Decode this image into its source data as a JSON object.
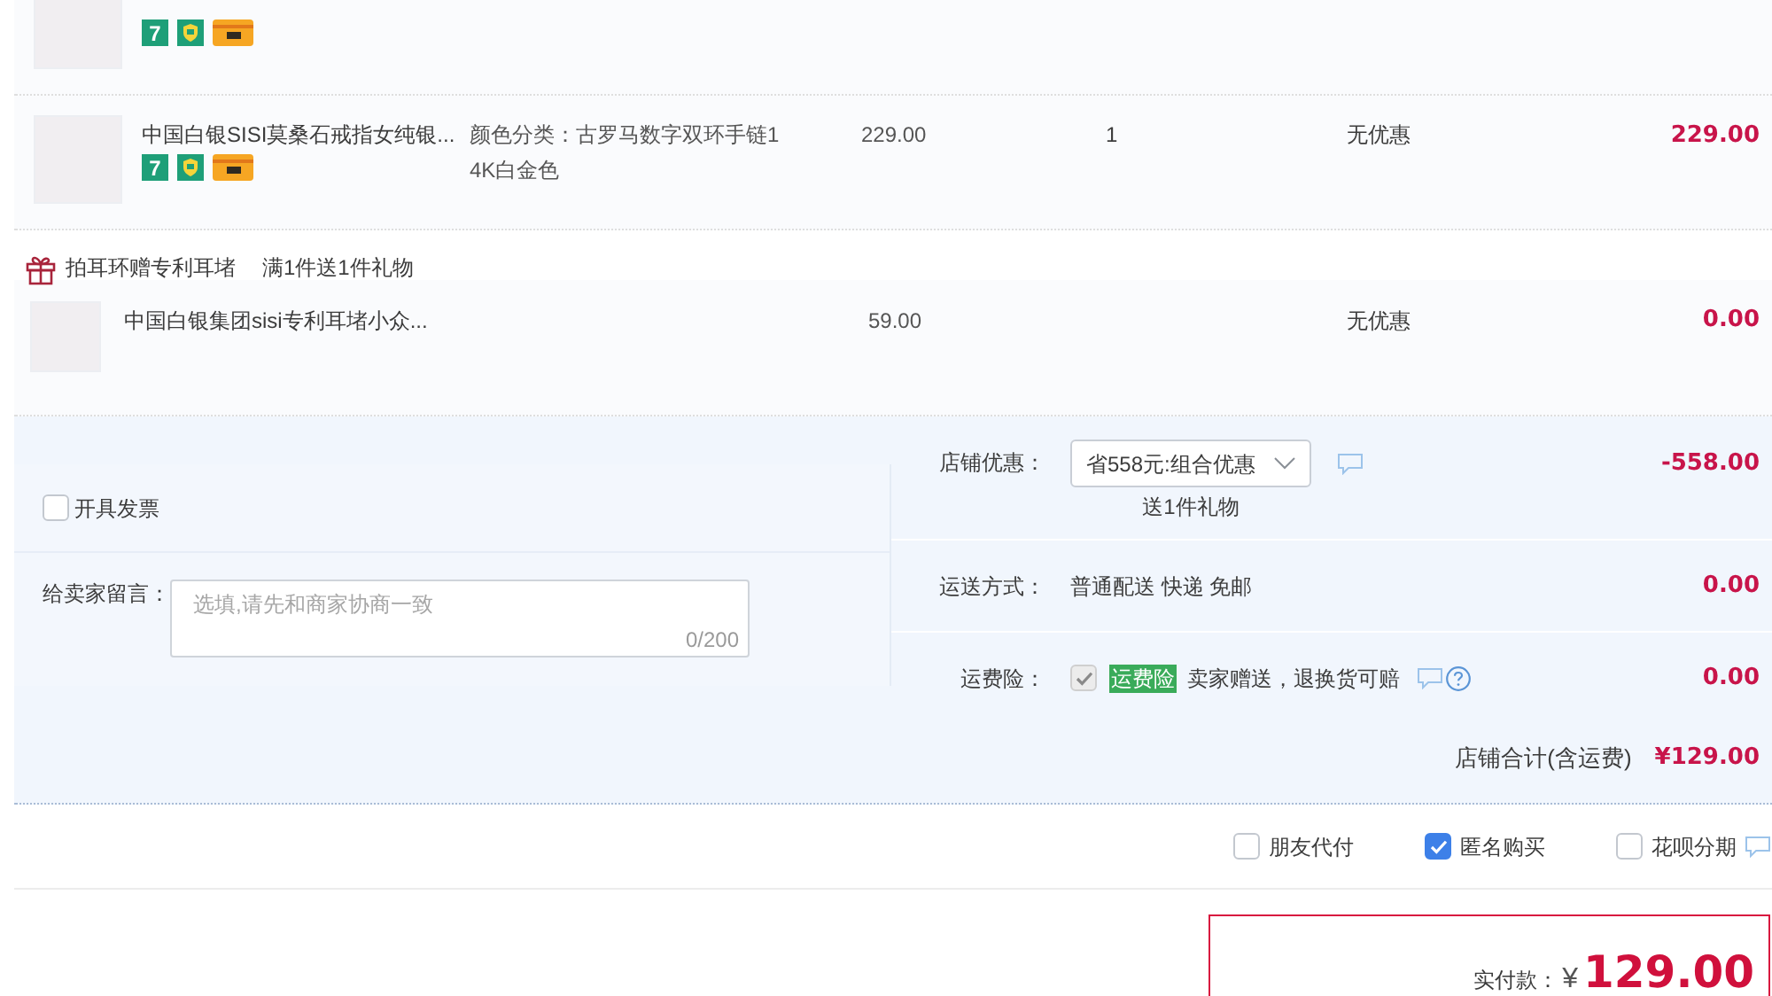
{
  "items": [
    {
      "badges": [
        {
          "kind": "seven",
          "label": "7"
        },
        {
          "kind": "shield"
        },
        {
          "kind": "card"
        }
      ]
    },
    {
      "title": "中国白银SISI莫桑石戒指女纯银...",
      "badges": [
        {
          "kind": "seven",
          "label": "7"
        },
        {
          "kind": "shield"
        },
        {
          "kind": "card"
        }
      ],
      "variant": "颜色分类：古罗马数字双环手链14K白金色",
      "price": "229.00",
      "quantity": "1",
      "discount": "无优惠",
      "subtotal": "229.00"
    }
  ],
  "gift_promo": {
    "name": "拍耳环赠专利耳堵",
    "rule": "满1件送1件礼物",
    "items": [
      {
        "title": "中国白银集团sisi专利耳堵小众...",
        "price": "59.00",
        "discount": "无优惠",
        "subtotal": "0.00"
      }
    ]
  },
  "invoice": {
    "label": "开具发票",
    "checked": false
  },
  "message": {
    "label": "给卖家留言：",
    "placeholder": "选填,请先和商家协商一致",
    "counter": "0/200"
  },
  "shop_discount": {
    "label": "店铺优惠：",
    "selection": "省558元:组合优惠",
    "note": "送1件礼物",
    "amount": "-558.00"
  },
  "shipping": {
    "label": "运送方式：",
    "method": "普通配送 快递 免邮",
    "amount": "0.00"
  },
  "shipping_insurance": {
    "label": "运费险：",
    "checked": true,
    "disabled": true,
    "tag": "运费险",
    "description": "卖家赠送，退换货可赔",
    "amount": "0.00"
  },
  "shop_total": {
    "label": "店铺合计(含运费)",
    "amount": "¥129.00"
  },
  "options": [
    {
      "label": "朋友代付",
      "checked": false
    },
    {
      "label": "匿名购买",
      "checked": true
    },
    {
      "label": "花呗分期",
      "checked": false
    }
  ],
  "payment": {
    "label": "实付款：",
    "currency": "¥",
    "amount": "129.00"
  }
}
